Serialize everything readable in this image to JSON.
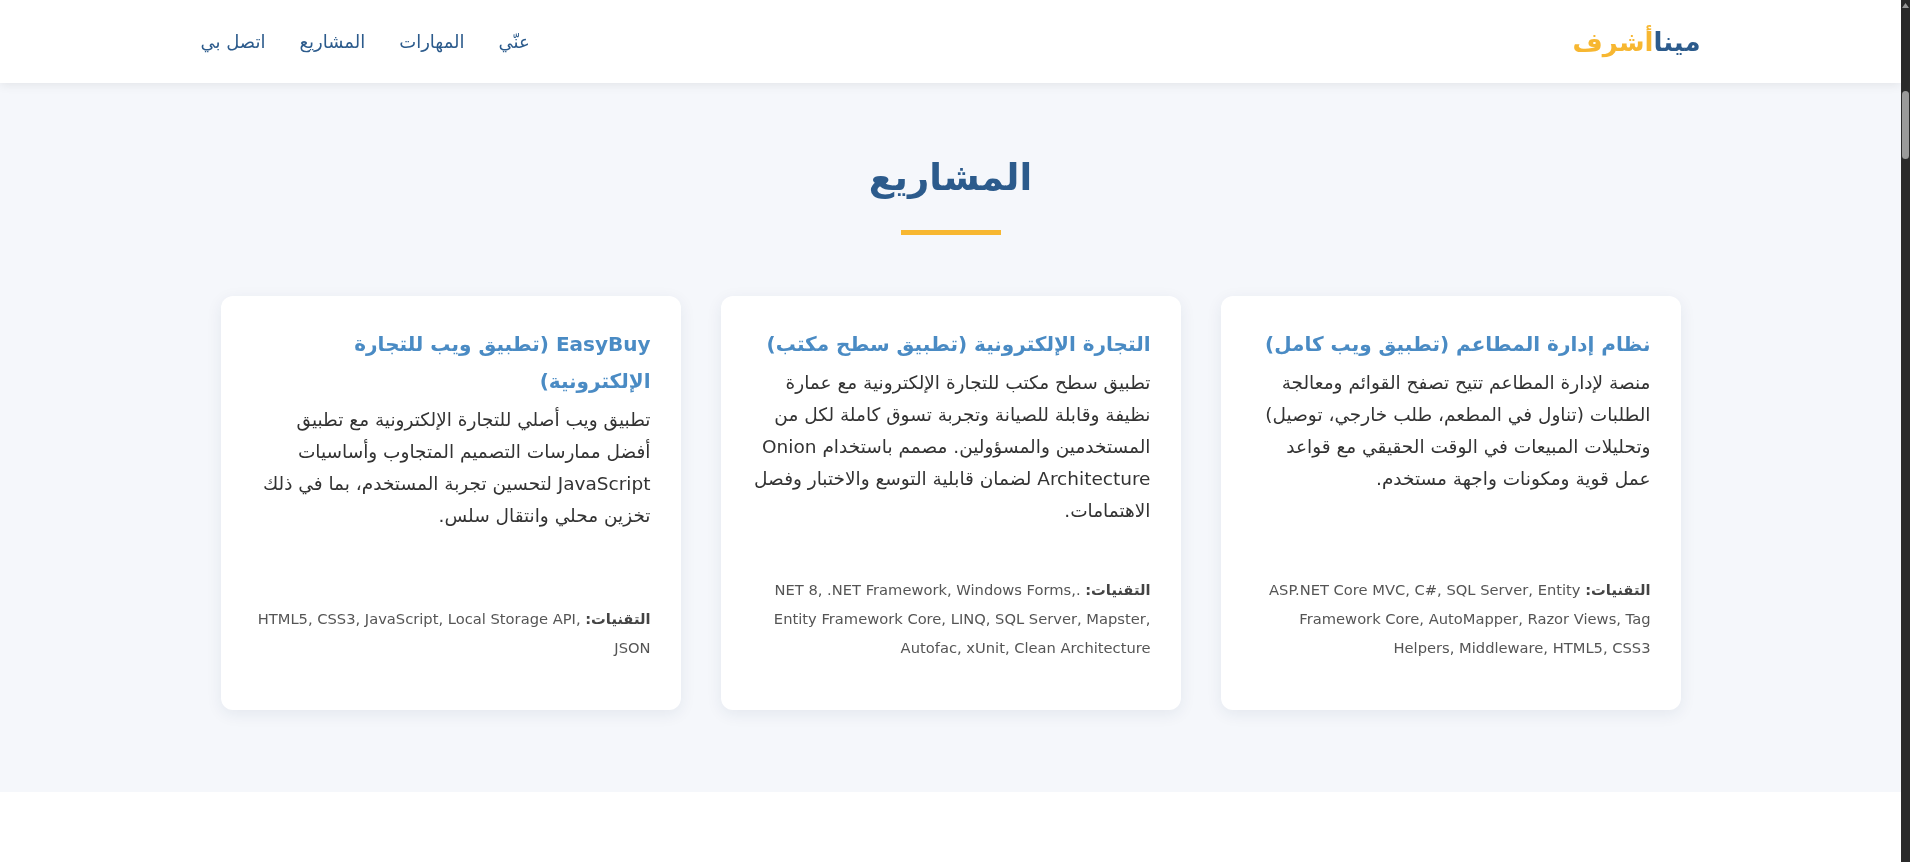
{
  "nav": {
    "logo": {
      "first": "مينا",
      "second": "أشرف"
    },
    "links": [
      "عنّي",
      "المهارات",
      "المشاريع",
      "اتصل بي"
    ]
  },
  "section": {
    "title": "المشاريع"
  },
  "projects": [
    {
      "title": "نظام إدارة المطاعم (تطبيق ويب كامل)",
      "description": "منصة لإدارة المطاعم تتيح تصفح القوائم ومعالجة الطلبات (تناول في المطعم، طلب خارجي، توصيل) وتحليلات المبيعات في الوقت الحقيقي مع قواعد عمل قوية ومكونات واجهة مستخدم.",
      "tech": "**التقنيات:** ASP.NET Core MVC, C#, SQL Server, Entity Framework Core, AutoMapper, Razor Views, Tag Helpers, Middleware, HTML5, CSS3"
    },
    {
      "title": "التجارة الإلكترونية (تطبيق سطح مكتب)",
      "description": "تطبيق سطح مكتب للتجارة الإلكترونية مع عمارة نظيفة وقابلة للصيانة وتجربة تسوق كاملة لكل من المستخدمين والمسؤولين. مصمم باستخدام Onion Architecture لضمان قابلية التوسع والاختبار وفصل الاهتمامات.",
      "tech": "**التقنيات:** .NET 8, .NET Framework, Windows Forms, Entity Framework Core, LINQ, SQL Server, Mapster, Autofac, xUnit, Clean Architecture"
    },
    {
      "title": "EasyBuy (تطبيق ويب للتجارة الإلكترونية)",
      "description": "تطبيق ويب أصلي للتجارة الإلكترونية مع تطبيق أفضل ممارسات التصميم المتجاوب وأساسيات JavaScript لتحسين تجربة المستخدم، بما في ذلك تخزين محلي وانتقال سلس.",
      "tech": "**التقنيات:** HTML5, CSS3, JavaScript, Local Storage API, JSON"
    }
  ]
}
